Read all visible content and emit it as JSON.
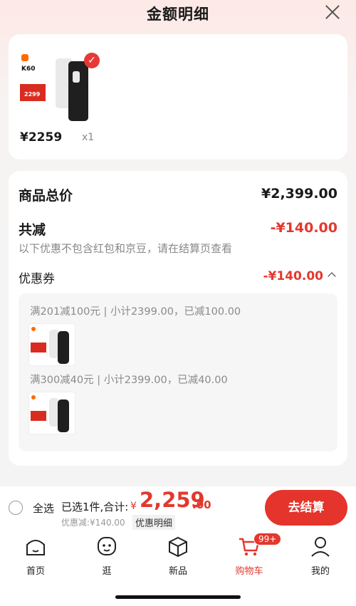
{
  "header": {
    "title": "金额明细"
  },
  "product_card": {
    "price": "¥2259",
    "quantity": "x1",
    "thumb": {
      "model_text": "K60",
      "promo_price": "2299"
    }
  },
  "summary": {
    "total_label": "商品总价",
    "total_value": "¥2,399.00",
    "reduce_label": "共减",
    "reduce_value": "-¥140.00",
    "note": "以下优惠不包含红包和京豆，请在结算页查看",
    "coupon_label": "优惠券",
    "coupon_value": "-¥140.00",
    "coupons": [
      {
        "text": "满201减100元 | 小计2399.00，已减100.00"
      },
      {
        "text": "满300减40元 | 小计2399.00，已减40.00"
      }
    ]
  },
  "checkout": {
    "select_all": "全选",
    "selected_count": "已选1件,合计:",
    "currency": "¥",
    "total_int": "2,259",
    "total_dec": ".00",
    "discount_note": "优惠减:¥140.00",
    "detail_link": "优惠明细",
    "button": "去结算"
  },
  "tabs": [
    {
      "label": "首页",
      "icon": "home-icon"
    },
    {
      "label": "逛",
      "icon": "face-icon"
    },
    {
      "label": "新品",
      "icon": "box-icon"
    },
    {
      "label": "购物车",
      "icon": "cart-icon",
      "badge": "99+"
    },
    {
      "label": "我的",
      "icon": "user-icon"
    }
  ],
  "colors": {
    "accent": "#e3382d",
    "button": "#e5342b"
  }
}
